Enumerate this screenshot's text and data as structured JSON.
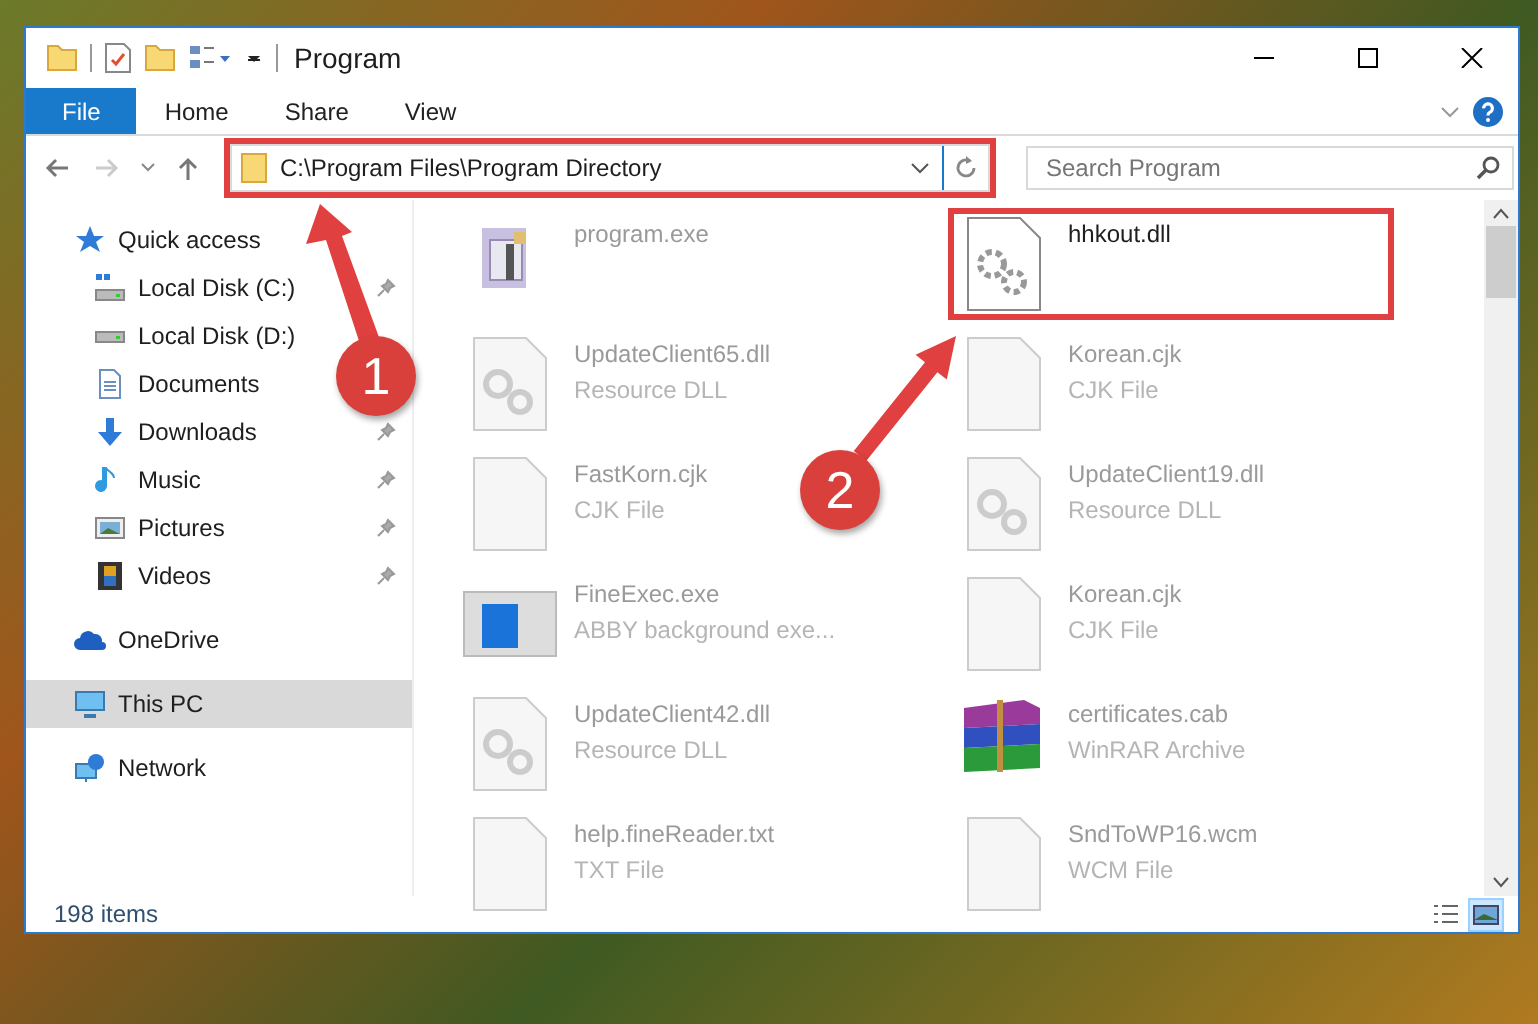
{
  "window": {
    "title": "Program"
  },
  "ribbon": {
    "tabs": [
      {
        "label": "File",
        "selected": true
      },
      {
        "label": "Home",
        "selected": false
      },
      {
        "label": "Share",
        "selected": false
      },
      {
        "label": "View",
        "selected": false
      }
    ]
  },
  "address_bar": {
    "path": "C:\\Program Files\\Program Directory",
    "highlighted": true
  },
  "search": {
    "placeholder": "Search Program"
  },
  "sidebar": {
    "items": [
      {
        "label": "Quick access",
        "kind": "star",
        "selected": false,
        "children": [
          {
            "label": "Local Disk (C:)",
            "kind": "drive-c",
            "pinned": true
          },
          {
            "label": "Local Disk (D:)",
            "kind": "drive"
          },
          {
            "label": "Documents",
            "kind": "documents"
          },
          {
            "label": "Downloads",
            "kind": "downloads",
            "pinned": true
          },
          {
            "label": "Music",
            "kind": "music",
            "pinned": true
          },
          {
            "label": "Pictures",
            "kind": "pictures",
            "pinned": true
          },
          {
            "label": "Videos",
            "kind": "videos",
            "pinned": true
          }
        ]
      },
      {
        "label": "OneDrive",
        "kind": "cloud",
        "selected": false
      },
      {
        "label": "This PC",
        "kind": "pc",
        "selected": true
      },
      {
        "label": "Network",
        "kind": "network",
        "selected": false
      }
    ]
  },
  "files": [
    {
      "name": "program.exe",
      "kind": "installer",
      "faded": true,
      "highlighted": false
    },
    {
      "name": "hhkout.dll",
      "kind": "gears",
      "faded": false,
      "highlighted": true
    },
    {
      "name": "UpdateClient65.dll",
      "type": "Resource DLL",
      "kind": "dll",
      "faded": true,
      "highlighted": false
    },
    {
      "name": "Korean.cjk",
      "type": "CJK File",
      "kind": "page",
      "faded": true,
      "highlighted": false
    },
    {
      "name": "FastKorn.cjk",
      "type": "CJK File",
      "kind": "page",
      "faded": true,
      "highlighted": false
    },
    {
      "name": "UpdateClient19.dll",
      "type": "Resource DLL",
      "kind": "dll",
      "faded": true,
      "highlighted": false
    },
    {
      "name": "FineExec.exe",
      "type": "ABBY background exe...",
      "kind": "window",
      "faded": true,
      "highlighted": false
    },
    {
      "name": "Korean.cjk",
      "type": "CJK File",
      "kind": "page",
      "faded": true,
      "highlighted": false
    },
    {
      "name": "UpdateClient42.dll",
      "type": "Resource DLL",
      "kind": "dll",
      "faded": true,
      "highlighted": false
    },
    {
      "name": "certificates.cab",
      "type": "WinRAR Archive",
      "kind": "archive",
      "faded": true,
      "highlighted": false
    },
    {
      "name": "help.fineReader.txt",
      "type": "TXT File",
      "kind": "page",
      "faded": true,
      "highlighted": false
    },
    {
      "name": "SndToWP16.wcm",
      "type": "WCM File",
      "kind": "page",
      "faded": true,
      "highlighted": false
    }
  ],
  "status_bar": {
    "count": "198 items",
    "views": [
      {
        "kind": "details",
        "selected": false
      },
      {
        "kind": "large-icons",
        "selected": true
      }
    ]
  },
  "callouts": [
    {
      "number": "1"
    },
    {
      "number": "2"
    }
  ]
}
